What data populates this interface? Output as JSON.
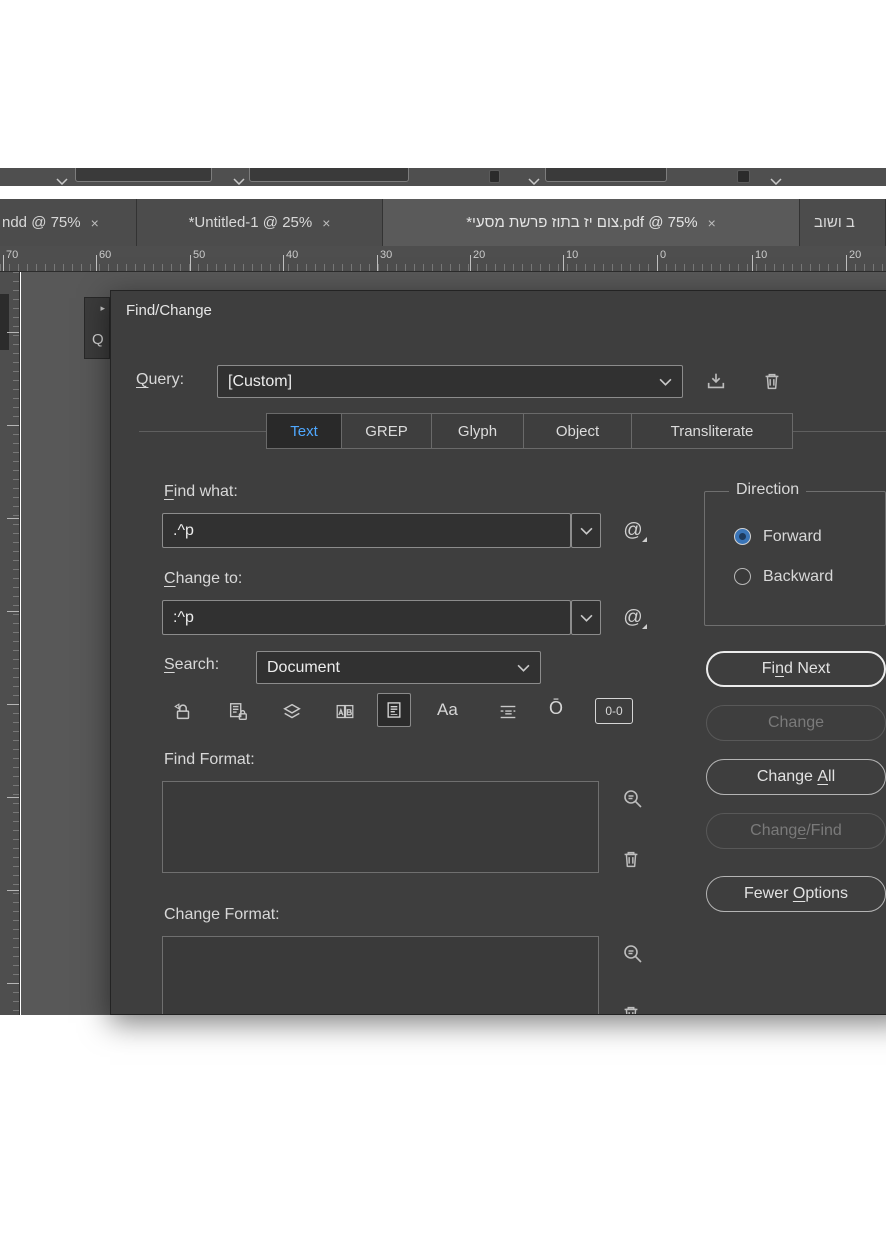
{
  "colors": {
    "dialog_bg": "#3e3e3e",
    "accent_blue": "#4fa8ff",
    "text_light": "#d6d6d6",
    "radio_selected_fill": "#3a75b8",
    "pasteboard": "#585858"
  },
  "document_tabs": [
    {
      "label": "ndd @ 75%",
      "close": "×"
    },
    {
      "label": "*Untitled-1 @ 25%",
      "close": "×"
    },
    {
      "label": "*צום יז בתוז פרשת מסעי.pdf @ 75%",
      "close": "×"
    },
    {
      "label": "ב ושוב",
      "close": ""
    }
  ],
  "ruler": {
    "h_numbers": [
      "70",
      "60",
      "50",
      "40",
      "30",
      "20",
      "10",
      "0",
      "10",
      "20"
    ]
  },
  "panel_fragment": {
    "arrow": "▸",
    "letter": "Q"
  },
  "dialog": {
    "title": "Find/Change",
    "query": {
      "label": {
        "pre": "",
        "mn": "Q",
        "post": "uery:"
      },
      "value": "[Custom]"
    },
    "tabs": [
      {
        "label": "Text"
      },
      {
        "label": "GREP"
      },
      {
        "label": "Glyph"
      },
      {
        "label": "Object"
      },
      {
        "label": "Transliterate"
      }
    ],
    "find_what": {
      "label": {
        "pre": "",
        "mn": "F",
        "post": "ind what:"
      },
      "value": ".^p"
    },
    "change_to": {
      "label": {
        "pre": "",
        "mn": "C",
        "post": "hange to:"
      },
      "value": ":^p"
    },
    "search": {
      "label": {
        "pre": "",
        "mn": "S",
        "post": "earch:"
      },
      "value": "Document"
    },
    "at_symbol": "@",
    "option_icons": {
      "case_sensitive": "Aa",
      "kashida": "Ō",
      "digits": "0-0"
    },
    "find_format": {
      "label": "Find Format:"
    },
    "change_format": {
      "label": "Change Format:"
    },
    "direction": {
      "label": "Direction",
      "forward": "Forward",
      "backward": "Backward"
    },
    "buttons": {
      "find_next": {
        "pre": "Fi",
        "mn": "n",
        "post": "d Next"
      },
      "change": {
        "pre": "Change",
        "mn": "",
        "post": ""
      },
      "change_all": {
        "pre": "Change ",
        "mn": "A",
        "post": "ll"
      },
      "change_find": {
        "pre": "Chang",
        "mn": "e",
        "post": "/Find"
      },
      "fewer_options": {
        "pre": "Fewer ",
        "mn": "O",
        "post": "ptions"
      }
    }
  }
}
